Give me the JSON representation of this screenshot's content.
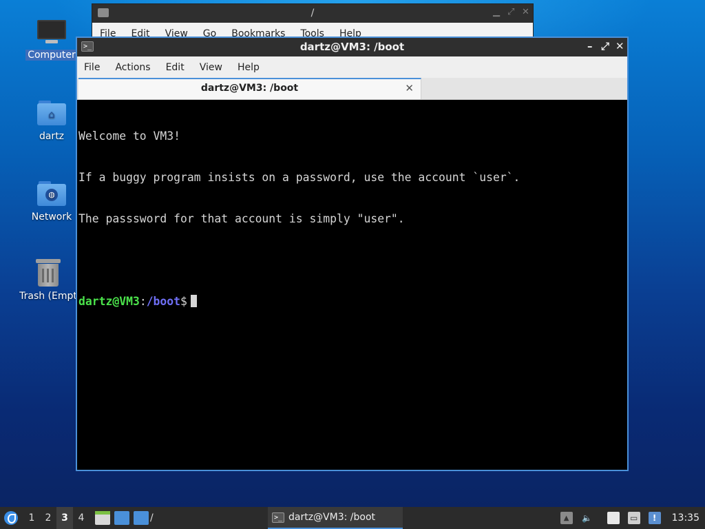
{
  "desktop": {
    "icons": [
      {
        "label": "Computer",
        "icon": "computer-icon"
      },
      {
        "label": "dartz",
        "icon": "home-folder-icon"
      },
      {
        "label": "Network",
        "icon": "network-folder-icon"
      },
      {
        "label": "Trash (Empt",
        "icon": "trash-icon"
      }
    ]
  },
  "file_manager": {
    "title": "/",
    "menu": [
      "File",
      "Edit",
      "View",
      "Go",
      "Bookmarks",
      "Tools",
      "Help"
    ]
  },
  "terminal": {
    "title": "dartz@VM3: /boot",
    "menu": [
      "File",
      "Actions",
      "Edit",
      "View",
      "Help"
    ],
    "tab_label": "dartz@VM3: /boot",
    "lines": [
      "Welcome to VM3!",
      "If a buggy program insists on a password, use the account `user`.",
      "The passsword for that account is simply \"user\"."
    ],
    "prompt": {
      "user_host": "dartz@VM3",
      "separator": ":",
      "path": "/boot",
      "symbol": "$"
    },
    "colors": {
      "user_host": "#4be34b",
      "path": "#6f6ff5",
      "text": "#d6d6d6",
      "background": "#000000"
    }
  },
  "taskbar": {
    "workspaces": [
      "1",
      "2",
      "3",
      "4"
    ],
    "active_workspace": "3",
    "launcher_folder_label": "/",
    "task_label": "dartz@VM3: /boot",
    "clock": "13:35"
  }
}
